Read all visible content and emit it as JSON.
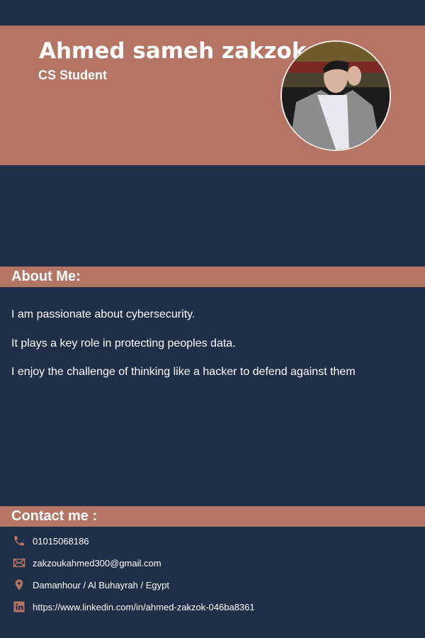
{
  "header": {
    "name": "Ahmed sameh zakzok",
    "role": "CS Student"
  },
  "about": {
    "title": "About Me:",
    "lines": [
      "I am passionate about cybersecurity.",
      "It plays a key role in protecting peoples data.",
      "I enjoy the challenge of thinking like a hacker to defend against them"
    ]
  },
  "contact": {
    "title": "Contact me :",
    "items": [
      {
        "icon": "phone-icon",
        "text": "01015068186"
      },
      {
        "icon": "mail-icon",
        "text": "zakzoukahmed300@gmail.com"
      },
      {
        "icon": "location-pin-icon",
        "text": "Damanhour / Al Buhayrah / Egypt"
      },
      {
        "icon": "linkedin-icon",
        "text": "https://www.linkedin.com/in/ahmed-zakzok-046ba8361"
      }
    ]
  },
  "colors": {
    "background": "#1f2f48",
    "accent": "#b57564"
  }
}
